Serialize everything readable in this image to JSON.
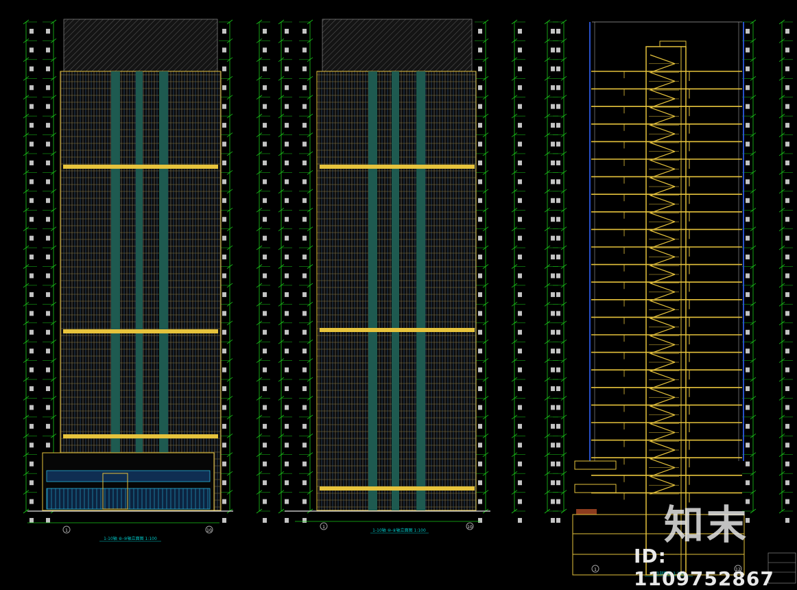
{
  "drawings": [
    {
      "caption": "1-10轴 ⑧-⑩轴立面图 1:100",
      "axis_left": "1",
      "axis_right": "10"
    },
    {
      "caption": "1-10轴 ⑩-⑧轴立面图 1:100",
      "axis_left": "1",
      "axis_right": "10"
    },
    {
      "caption": "1-1剖面图 1:100",
      "axis_left": "1",
      "axis_right": "12"
    }
  ],
  "floor_count": 26,
  "watermark": {
    "logo": "知末",
    "id_label": "ID: 1109752867"
  },
  "colors": {
    "background": "#000000",
    "dimension_green": "#19c819",
    "wall_yellow": "#e6c33c",
    "grid_gray": "#a0a0a0",
    "glass_blue": "#28b4dc",
    "panel_teal": "#1e5a50",
    "caption_cyan": "#00c8c8"
  }
}
